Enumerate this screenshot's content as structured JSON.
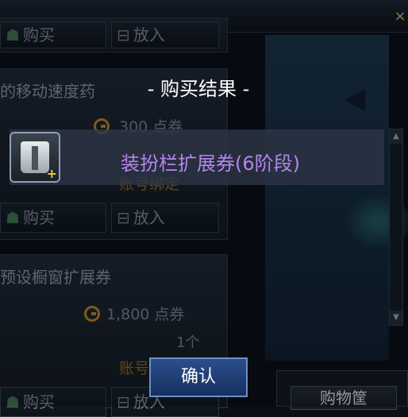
{
  "shop": {
    "close_symbol": "×",
    "top_card": {
      "buy_label": "购买",
      "put_label": "放入"
    },
    "mid_card": {
      "name": "的移动速度药",
      "price": "300 点券",
      "bind": "账号绑定",
      "buy_label": "购买",
      "put_label": "放入"
    },
    "bot_card": {
      "name": "预设橱窗扩展券",
      "price": "1,800 点券",
      "quantity": "1个",
      "bind": "账号",
      "buy_label": "购买",
      "put_label": "放入"
    },
    "cart_label": "购物筐"
  },
  "modal": {
    "title": "- 购买结果 -",
    "item_name": "装扮栏扩展券(6阶段)",
    "confirm_label": "确认"
  },
  "colors": {
    "accent_purple": "#b585ef",
    "confirm_blue": "#2c4e8c"
  }
}
